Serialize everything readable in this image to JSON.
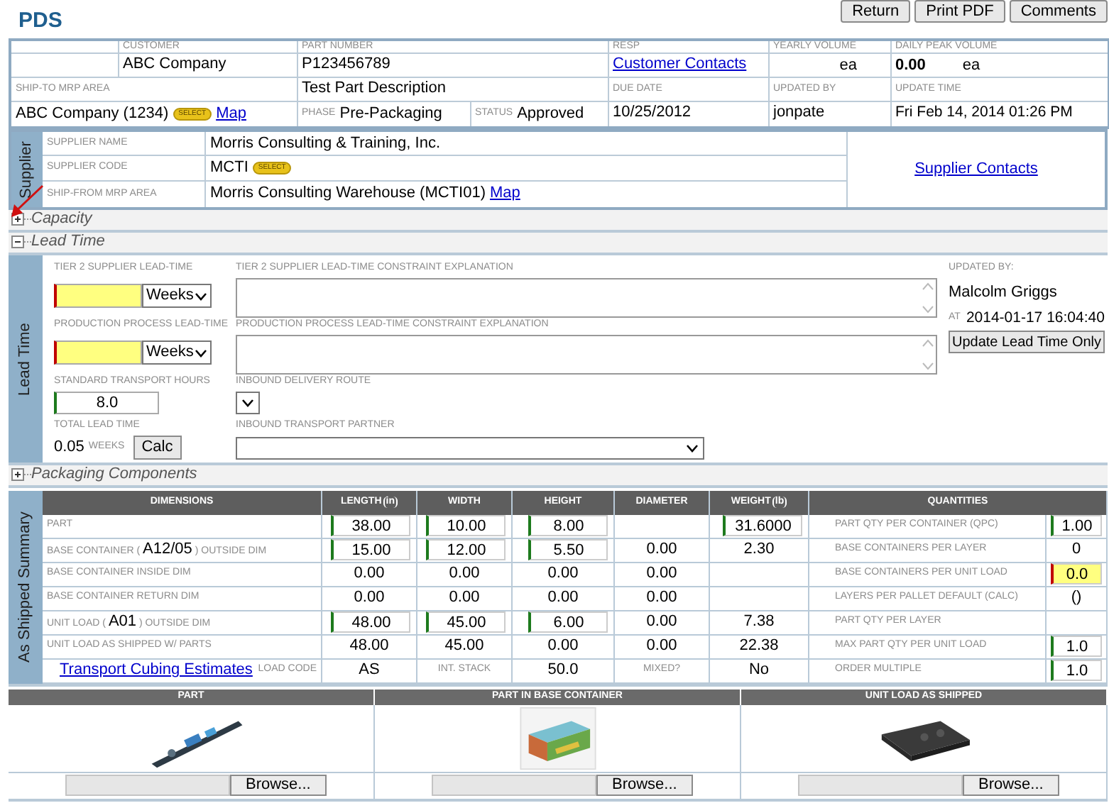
{
  "title": "PDS",
  "buttons": [
    "Return",
    "Print PDF",
    "Comments"
  ],
  "header": {
    "customer": {
      "label": "CUSTOMER",
      "value": "ABC Company"
    },
    "part_number": {
      "label": "PART NUMBER",
      "value": "P123456789"
    },
    "resp": {
      "label": "RESP",
      "link": "Customer Contacts"
    },
    "yearly_volume": {
      "label": "YEARLY VOLUME",
      "unit": "ea"
    },
    "daily_peak_volume": {
      "label": "DAILY PEAK VOLUME",
      "value": "0.00",
      "unit": "ea"
    },
    "ship_to": {
      "label": "SHIP-TO MRP AREA",
      "value": "ABC Company (1234)",
      "select": "SELECT",
      "link": "Map"
    },
    "description": "Test Part Description",
    "phase": {
      "label": "PHASE",
      "value": "Pre-Packaging"
    },
    "status": {
      "label": "STATUS",
      "value": "Approved"
    },
    "due_date": {
      "label": "DUE DATE",
      "value": "10/25/2012"
    },
    "updated_by": {
      "label": "UPDATED BY",
      "value": "jonpate"
    },
    "update_time": {
      "label": "UPDATE TIME",
      "value": "Fri Feb 14, 2014 01:26 PM"
    }
  },
  "supplier": {
    "tab": "Supplier",
    "contacts_link": "Supplier Contacts",
    "rows": [
      {
        "label": "SUPPLIER NAME",
        "value": "Morris Consulting & Training, Inc."
      },
      {
        "label": "SUPPLIER CODE",
        "value": "MCTI",
        "select": "SELECT"
      },
      {
        "label": "SHIP-FROM MRP AREA",
        "value": "Morris Consulting Warehouse (MCTI01)",
        "link": "Map"
      }
    ]
  },
  "sections": [
    {
      "title": "Capacity",
      "expanded": false
    },
    {
      "title": "Lead Time",
      "expanded": true
    },
    {
      "title": "Packaging Components",
      "expanded": false
    }
  ],
  "lead_time": {
    "tab": "Lead Time",
    "tier2": {
      "label": "TIER 2 SUPPLIER LEAD-TIME",
      "unit": "Weeks",
      "missing": true
    },
    "tier2_explanation": {
      "label": "TIER 2 SUPPLIER LEAD-TIME CONSTRAINT EXPLANATION"
    },
    "production": {
      "label": "PRODUCTION PROCESS LEAD-TIME",
      "unit": "Weeks",
      "missing": true
    },
    "production_explanation": {
      "label": "PRODUCTION PROCESS LEAD-TIME CONSTRAINT EXPLANATION"
    },
    "transport_hours": {
      "label": "STANDARD TRANSPORT HOURS",
      "value": "8.0",
      "missing": false
    },
    "delivery_route": {
      "label": "INBOUND DELIVERY ROUTE"
    },
    "total": {
      "label": "TOTAL LEAD TIME",
      "value": "0.05",
      "unit": "WEEKS",
      "button": "Calc"
    },
    "transport_partner": {
      "label": "INBOUND TRANSPORT PARTNER"
    },
    "updated": {
      "label": "UPDATED BY:",
      "value": "Malcolm Griggs",
      "at_label": "AT",
      "at": "2014-01-17 16:04:40"
    },
    "update_button": "Update Lead Time Only"
  },
  "summary": {
    "tab": "As Shipped Summary",
    "columns": [
      {
        "label": "DIMENSIONS"
      },
      {
        "label": "LENGTH",
        "unit": "in"
      },
      {
        "label": "WIDTH"
      },
      {
        "label": "HEIGHT"
      },
      {
        "label": "DIAMETER"
      },
      {
        "label": "WEIGHT",
        "unit": "lb"
      },
      {
        "label": "QUANTITIES"
      }
    ],
    "rows": [
      {
        "cells": [
          {
            "kind": "label",
            "text": "PART"
          },
          {
            "kind": "input",
            "text": "38.00",
            "missing": false
          },
          {
            "kind": "input",
            "text": "10.00",
            "missing": false
          },
          {
            "kind": "input",
            "text": "8.00",
            "missing": false
          },
          {
            "kind": "empty"
          },
          {
            "kind": "input",
            "text": "31.6000",
            "missing": false
          },
          {
            "kind": "label",
            "text": "PART QTY PER CONTAINER (QPC)"
          },
          {
            "kind": "input",
            "text": "1.00",
            "missing": false
          }
        ]
      },
      {
        "cells": [
          {
            "kind": "label",
            "text": "BASE CONTAINER (",
            "code": "A12/05",
            "after": ") OUTSIDE DIM"
          },
          {
            "kind": "input",
            "text": "15.00",
            "missing": false
          },
          {
            "kind": "input",
            "text": "12.00",
            "missing": false
          },
          {
            "kind": "input",
            "text": "5.50",
            "missing": false
          },
          {
            "kind": "value",
            "text": "0.00"
          },
          {
            "kind": "value",
            "text": "2.30"
          },
          {
            "kind": "label",
            "text": "BASE CONTAINERS PER LAYER"
          },
          {
            "kind": "value",
            "text": "0"
          }
        ]
      },
      {
        "cells": [
          {
            "kind": "label",
            "text": "BASE CONTAINER INSIDE DIM"
          },
          {
            "kind": "value",
            "text": "0.00"
          },
          {
            "kind": "value",
            "text": "0.00"
          },
          {
            "kind": "value",
            "text": "0.00"
          },
          {
            "kind": "value",
            "text": "0.00"
          },
          {
            "kind": "empty"
          },
          {
            "kind": "label",
            "text": "BASE CONTAINERS PER UNIT LOAD"
          },
          {
            "kind": "input",
            "text": "0.0",
            "missing": true
          }
        ]
      },
      {
        "cells": [
          {
            "kind": "label",
            "text": "BASE CONTAINER RETURN DIM"
          },
          {
            "kind": "value",
            "text": "0.00"
          },
          {
            "kind": "value",
            "text": "0.00"
          },
          {
            "kind": "value",
            "text": "0.00"
          },
          {
            "kind": "value",
            "text": "0.00"
          },
          {
            "kind": "empty"
          },
          {
            "kind": "label",
            "text": "LAYERS PER PALLET DEFAULT (CALC)"
          },
          {
            "kind": "value",
            "text": "()"
          }
        ]
      },
      {
        "cells": [
          {
            "kind": "label",
            "text": "UNIT LOAD (",
            "code": "A01",
            "after": ") OUTSIDE DIM"
          },
          {
            "kind": "input",
            "text": "48.00",
            "missing": false
          },
          {
            "kind": "input",
            "text": "45.00",
            "missing": false
          },
          {
            "kind": "input",
            "text": "6.00",
            "missing": false
          },
          {
            "kind": "value",
            "text": "0.00"
          },
          {
            "kind": "value",
            "text": "7.38"
          },
          {
            "kind": "label",
            "text": "PART QTY PER LAYER"
          },
          {
            "kind": "empty"
          }
        ]
      },
      {
        "cells": [
          {
            "kind": "label",
            "text": "UNIT LOAD AS SHIPPED W/ PARTS"
          },
          {
            "kind": "value",
            "text": "48.00"
          },
          {
            "kind": "value",
            "text": "45.00"
          },
          {
            "kind": "value",
            "text": "0.00"
          },
          {
            "kind": "value",
            "text": "0.00"
          },
          {
            "kind": "value",
            "text": "22.38"
          },
          {
            "kind": "label",
            "text": "MAX PART QTY PER UNIT LOAD"
          },
          {
            "kind": "input",
            "text": "1.0",
            "missing": false
          }
        ]
      },
      {
        "cells": [
          {
            "kind": "link",
            "text": "Transport Cubing Estimates",
            "note": "LOAD CODE"
          },
          {
            "kind": "value",
            "text": "AS"
          },
          {
            "kind": "note",
            "text": "INT. STACK"
          },
          {
            "kind": "value",
            "text": "50.0"
          },
          {
            "kind": "note",
            "text": "MIXED?"
          },
          {
            "kind": "value",
            "text": "No"
          },
          {
            "kind": "label",
            "text": "ORDER MULTIPLE"
          },
          {
            "kind": "input",
            "text": "1.0",
            "missing": false
          }
        ]
      }
    ]
  },
  "images": [
    {
      "heading": "PART",
      "button": "Browse...",
      "kind": "picture"
    },
    {
      "heading": "PART IN BASE CONTAINER",
      "button": "Browse...",
      "kind": "picture"
    },
    {
      "heading": "UNIT LOAD AS SHIPPED",
      "button": "Browse...",
      "kind": "picture"
    }
  ]
}
